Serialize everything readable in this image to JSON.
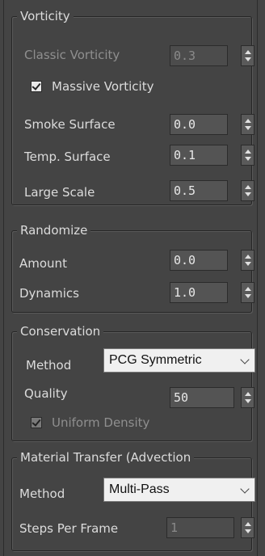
{
  "vorticity": {
    "title": "Vorticity",
    "classic_label": "Classic Vorticity",
    "classic_value": "0.3",
    "massive_label": "Massive Vorticity",
    "massive_checked": true,
    "smoke_label": "Smoke Surface",
    "smoke_value": "0.0",
    "temp_label": "Temp. Surface",
    "temp_value": "0.1",
    "large_label": "Large Scale",
    "large_value": "0.5"
  },
  "randomize": {
    "title": "Randomize",
    "amount_label": "Amount",
    "amount_value": "0.0",
    "dynamics_label": "Dynamics",
    "dynamics_value": "1.0"
  },
  "conservation": {
    "title": "Conservation",
    "method_label": "Method",
    "method_value": "PCG Symmetric",
    "quality_label": "Quality",
    "quality_value": "50",
    "uniform_label": "Uniform Density",
    "uniform_checked": true
  },
  "material_transfer": {
    "title": "Material Transfer (Advection",
    "method_label": "Method",
    "method_value": "Multi-Pass",
    "steps_label": "Steps Per Frame",
    "steps_value": "1"
  },
  "colors": {
    "panel_bg": "#444444",
    "text": "#dcdcdc",
    "disabled_text": "#8a8a8a",
    "input_bg": "#545454",
    "select_bg": "#f0f0f0"
  },
  "icons": [
    "spinner-icon",
    "checkmark-icon",
    "chevron-down-icon"
  ]
}
